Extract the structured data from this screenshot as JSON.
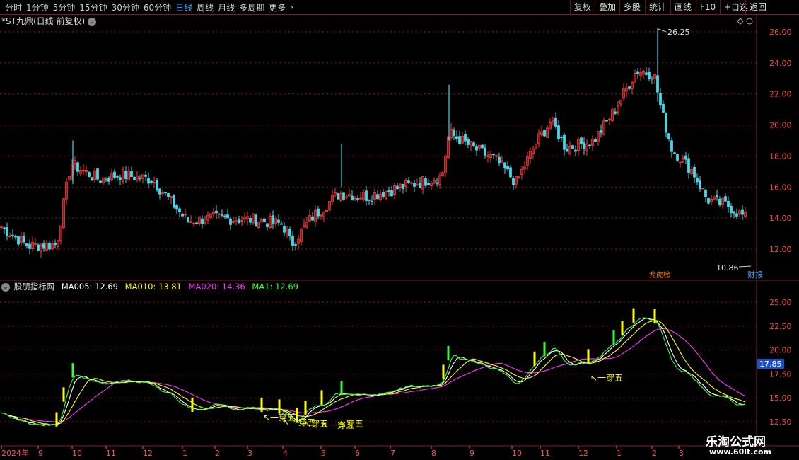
{
  "toolbar": {
    "periods": [
      "分时",
      "1分钟",
      "5分钟",
      "15分钟",
      "30分钟",
      "60分钟",
      "日线",
      "周线",
      "月线",
      "多周期",
      "更多"
    ],
    "active_period": "日线",
    "right_buttons": [
      "复权",
      "叠加",
      "多股",
      "统计",
      "画线",
      "F10",
      "+自选",
      "返回"
    ]
  },
  "stock": {
    "title": "*ST九鼎(日线 前复权)"
  },
  "main_chart": {
    "y_ticks": [
      "26.00",
      "24.00",
      "22.00",
      "20.00",
      "18.00",
      "16.00",
      "14.00",
      "12.00"
    ],
    "high_label": "26.25",
    "low_label": "10.86",
    "badge_right": "财报",
    "badge_mid": "龙虎榜"
  },
  "indicator": {
    "name": "股朋指标网",
    "ma005": "MA005: 12.69",
    "ma010": "MA010: 13.81",
    "ma020": "MA020: 14.36",
    "ma1": "MA1: 12.69",
    "y_ticks": [
      "25.00",
      "22.50",
      "20.00",
      "17.50",
      "15.00",
      "12.50"
    ],
    "current_value": "17.85",
    "annotations": [
      "一穿五",
      "一穿五",
      "穿五",
      "一穿五",
      "穿五",
      "一穿五"
    ]
  },
  "xaxis": {
    "labels": [
      "2024年",
      "9",
      "10",
      "11",
      "12",
      "1",
      "2",
      "3",
      "4",
      "5",
      "6",
      "7",
      "8",
      "9",
      "10",
      "11",
      "12",
      "1",
      "2",
      "3"
    ]
  },
  "watermark": {
    "line1": "乐淘公式网",
    "line2": "www.60lt.com"
  },
  "colors": {
    "up": "#ff3b3b",
    "down": "#4ad6e6",
    "ma5": "#ffffff",
    "ma10": "#ffff00",
    "ma20": "#ff33ff",
    "ma1": "#33ff33",
    "grid": "#8b1a1a"
  }
}
